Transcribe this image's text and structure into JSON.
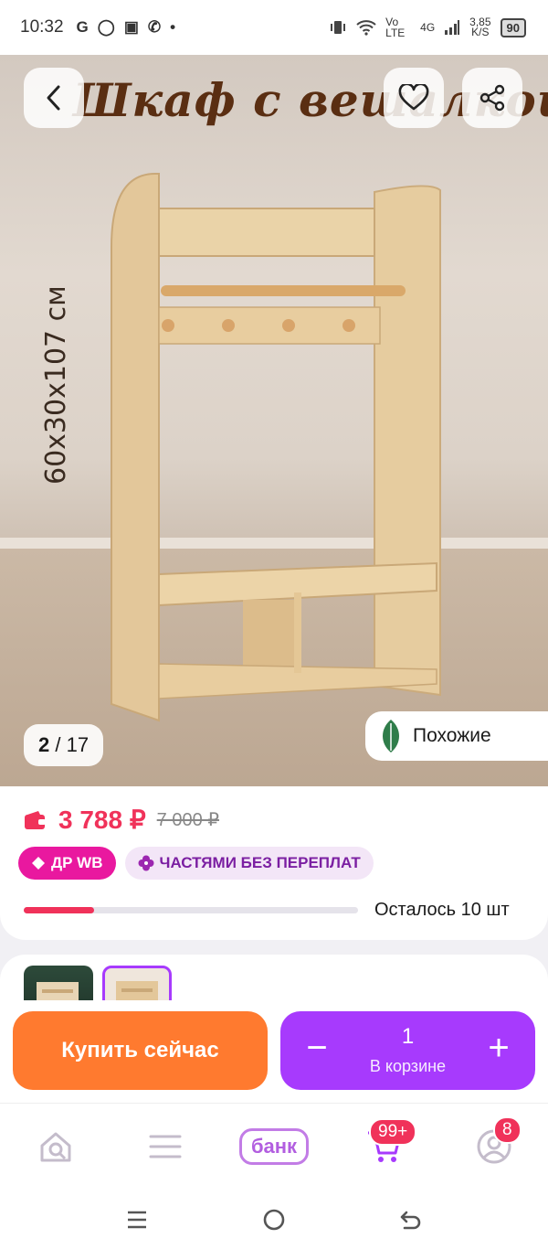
{
  "status_bar": {
    "time": "10:32",
    "app_icons": [
      "G",
      "◯",
      "▣",
      "✆",
      "•"
    ],
    "network_label": "Vo LTE",
    "signal_label": "4G",
    "speed_value": "3,85",
    "speed_unit": "K/S",
    "battery": "90"
  },
  "photo": {
    "title": "Шкаф с вешалкой",
    "dimensions": "60х30х107 см",
    "counter_current": "2",
    "counter_total": "/ 17",
    "similar_label": "Похожие"
  },
  "price": {
    "current": "3 788 ₽",
    "old": "7 000 ₽",
    "badge_wb": "ДР WB",
    "badge_installments": "ЧАСТЯМИ БЕЗ ПЕРЕПЛАТ",
    "stock_text": "Осталось 10 шт",
    "stock_fraction": 0.21
  },
  "actions": {
    "buy_now": "Купить сейчас",
    "cart_qty": "1",
    "cart_label": "В корзине",
    "minus": "−",
    "plus": "+"
  },
  "bottom_nav": {
    "bank_label": "банк",
    "cart_badge": "99+",
    "profile_badge": "8"
  },
  "colors": {
    "accent_pink": "#f0325a",
    "buy_orange": "#ff7a2f",
    "cart_purple": "#a73afd"
  }
}
